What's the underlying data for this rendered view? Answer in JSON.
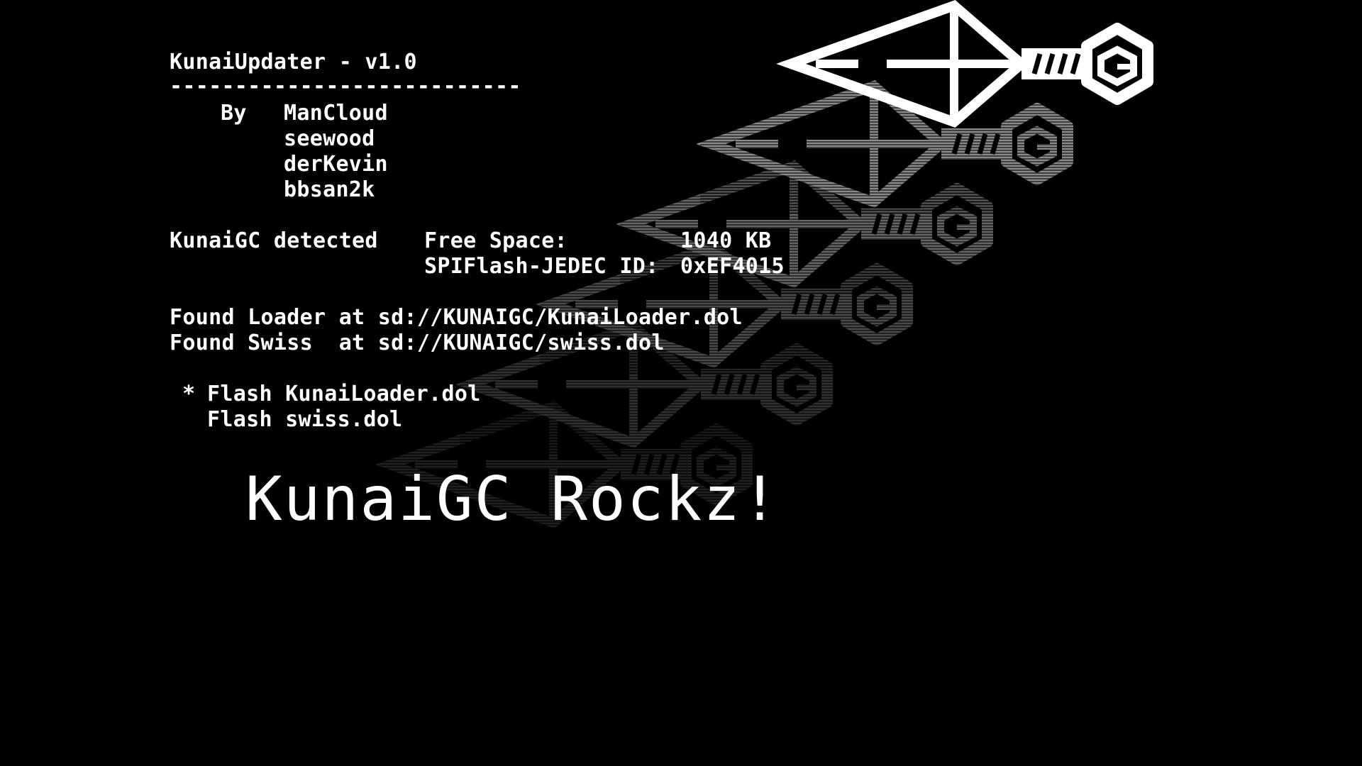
{
  "header": {
    "title": "KunaiUpdater - v1.0",
    "rule": "---------------------------"
  },
  "credits": {
    "label": "By",
    "authors": [
      "ManCloud",
      "seewood",
      "derKevin",
      "bbsan2k"
    ]
  },
  "device": {
    "status": "KunaiGC detected",
    "free_space_label": "Free Space:",
    "free_space_value": "1040 KB",
    "jedec_label": "SPIFlash-JEDEC ID:",
    "jedec_value": "0xEF4015"
  },
  "found": [
    "Found Loader at sd://KUNAIGC/KunaiLoader.dol",
    "Found Swiss  at sd://KUNAIGC/swiss.dol"
  ],
  "menu": {
    "cursor": "*",
    "items": [
      "Flash KunaiLoader.dol",
      "Flash swiss.dol"
    ],
    "selected_index": 0
  },
  "banner": "KunaiGC Rockz!",
  "logo": {
    "name": "kunai-gamecube-icon",
    "trail_count": 6,
    "colors": [
      "#ffffff",
      "#8a8a8a",
      "#666666",
      "#4a4a4a",
      "#303030",
      "#202020"
    ]
  }
}
